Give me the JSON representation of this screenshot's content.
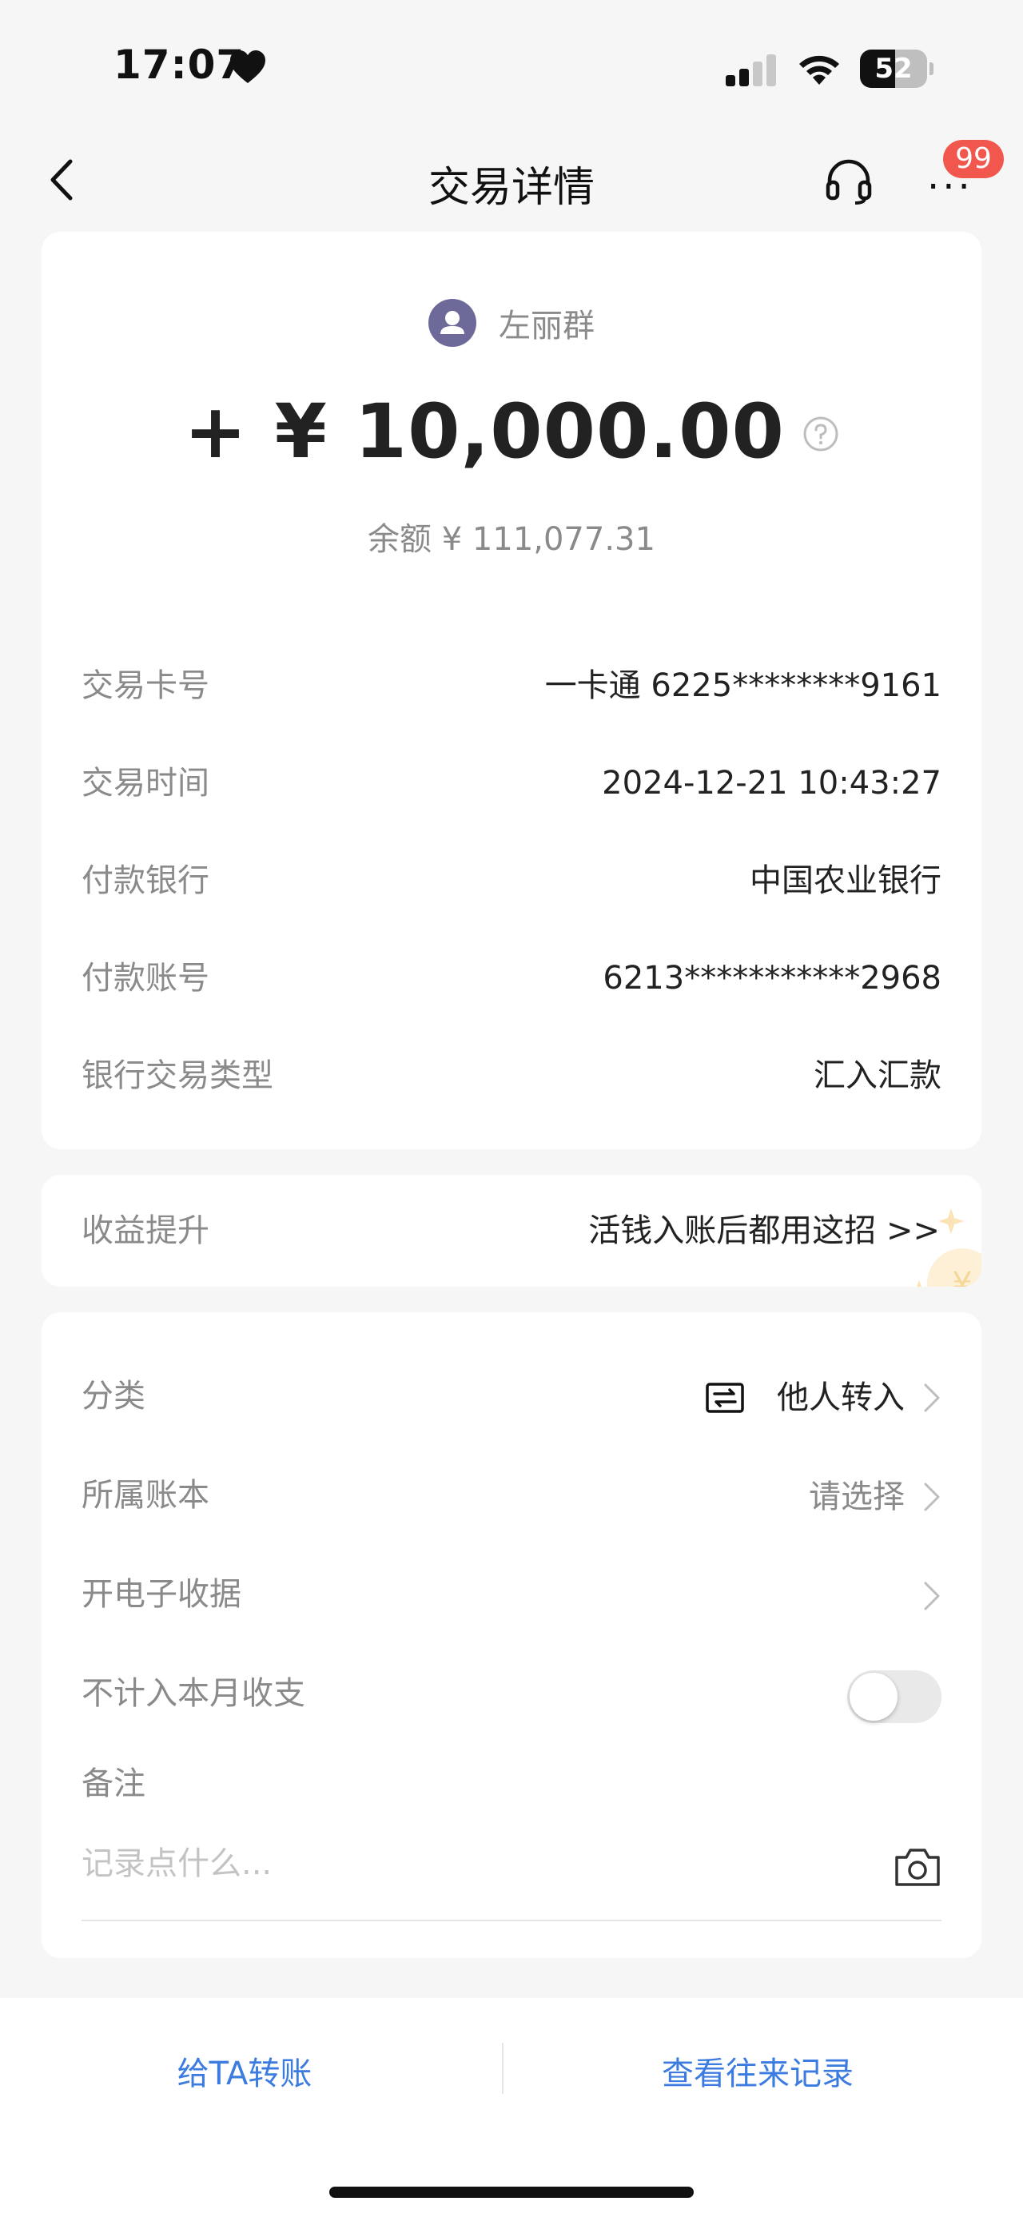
{
  "status_bar": {
    "time": "17:07",
    "battery_level": "52",
    "battery_fraction": 0.52
  },
  "nav": {
    "title": "交易详情",
    "more_glyph": "···",
    "badge_count": "99",
    "icons": [
      "chevron-left-icon",
      "headset-icon",
      "more-icon"
    ]
  },
  "summary": {
    "payer_name": "左丽群",
    "amount": "+ ¥ 10,000.00",
    "balance": "余额 ¥ 111,077.31",
    "details": [
      {
        "label": "交易卡号",
        "value": "一卡通 6225********9161"
      },
      {
        "label": "交易时间",
        "value": "2024-12-21 10:43:27"
      },
      {
        "label": "付款银行",
        "value": "中国农业银行"
      },
      {
        "label": "付款账号",
        "value": "6213***********2968"
      },
      {
        "label": "银行交易类型",
        "value": "汇入汇款"
      }
    ]
  },
  "benefit": {
    "label": "收益提升",
    "link": "活钱入账后都用这招 >>"
  },
  "settings": {
    "category": {
      "label": "分类",
      "value": "他人转入"
    },
    "ledger": {
      "label": "所属账本",
      "value": "请选择"
    },
    "receipt": {
      "label": "开电子收据"
    },
    "exclude": {
      "label": "不计入本月收支",
      "enabled": false
    },
    "note": {
      "label": "备注",
      "placeholder": "记录点什么..."
    }
  },
  "bottom": {
    "transfer": "给TA转账",
    "history": "查看往来记录"
  },
  "colors": {
    "accent_blue": "#3c7ce0",
    "badge_red": "#f2574e",
    "avatar": "#6d6a9a",
    "muted_text": "#8a8a8a"
  }
}
